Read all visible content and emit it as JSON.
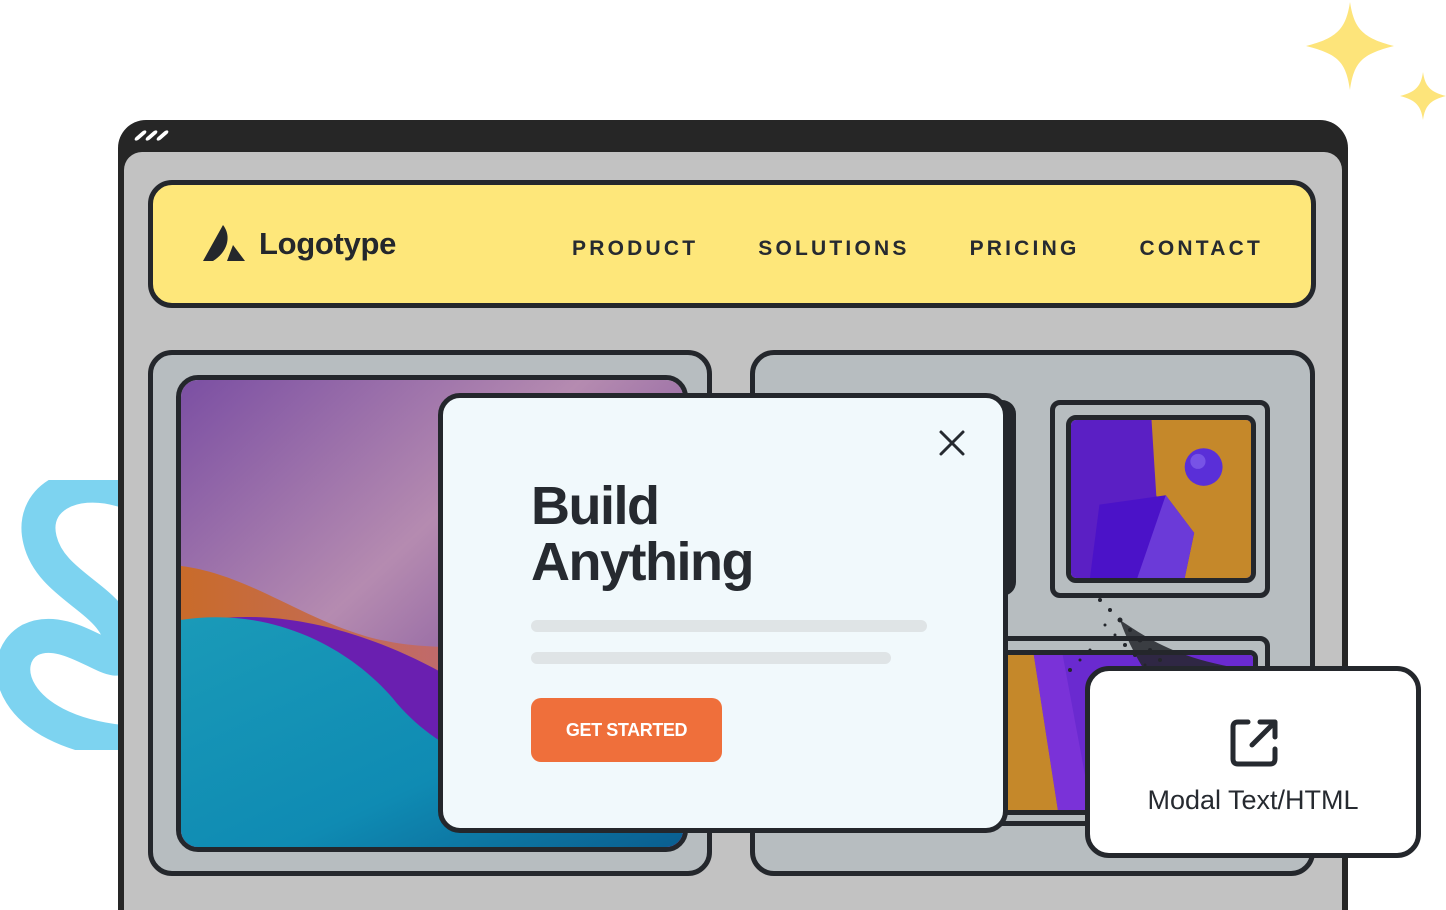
{
  "colors": {
    "navbar_bg": "#fee77a",
    "canvas_bg": "#c2c2c2",
    "panel_bg": "#b7bdc0",
    "outline": "#24272c",
    "modal_bg": "#f1f9fc",
    "cta": "#ef6f3b",
    "squiggle": "#7dd3f0",
    "sparkle": "#fde47a"
  },
  "window": {
    "controls_icon": "window-dots"
  },
  "navbar": {
    "logo_icon": "logotype-mark",
    "logo_text": "Logotype",
    "links": [
      {
        "label": "PRODUCT"
      },
      {
        "label": "SOLUTIONS"
      },
      {
        "label": "PRICING"
      },
      {
        "label": "CONTACT"
      }
    ]
  },
  "modal": {
    "close_icon": "close-icon",
    "title_line1": "Build",
    "title_line2": "Anything",
    "cta_label": "GET STARTED"
  },
  "feature_card": {
    "icon": "external-link-icon",
    "label": "Modal Text/HTML"
  }
}
